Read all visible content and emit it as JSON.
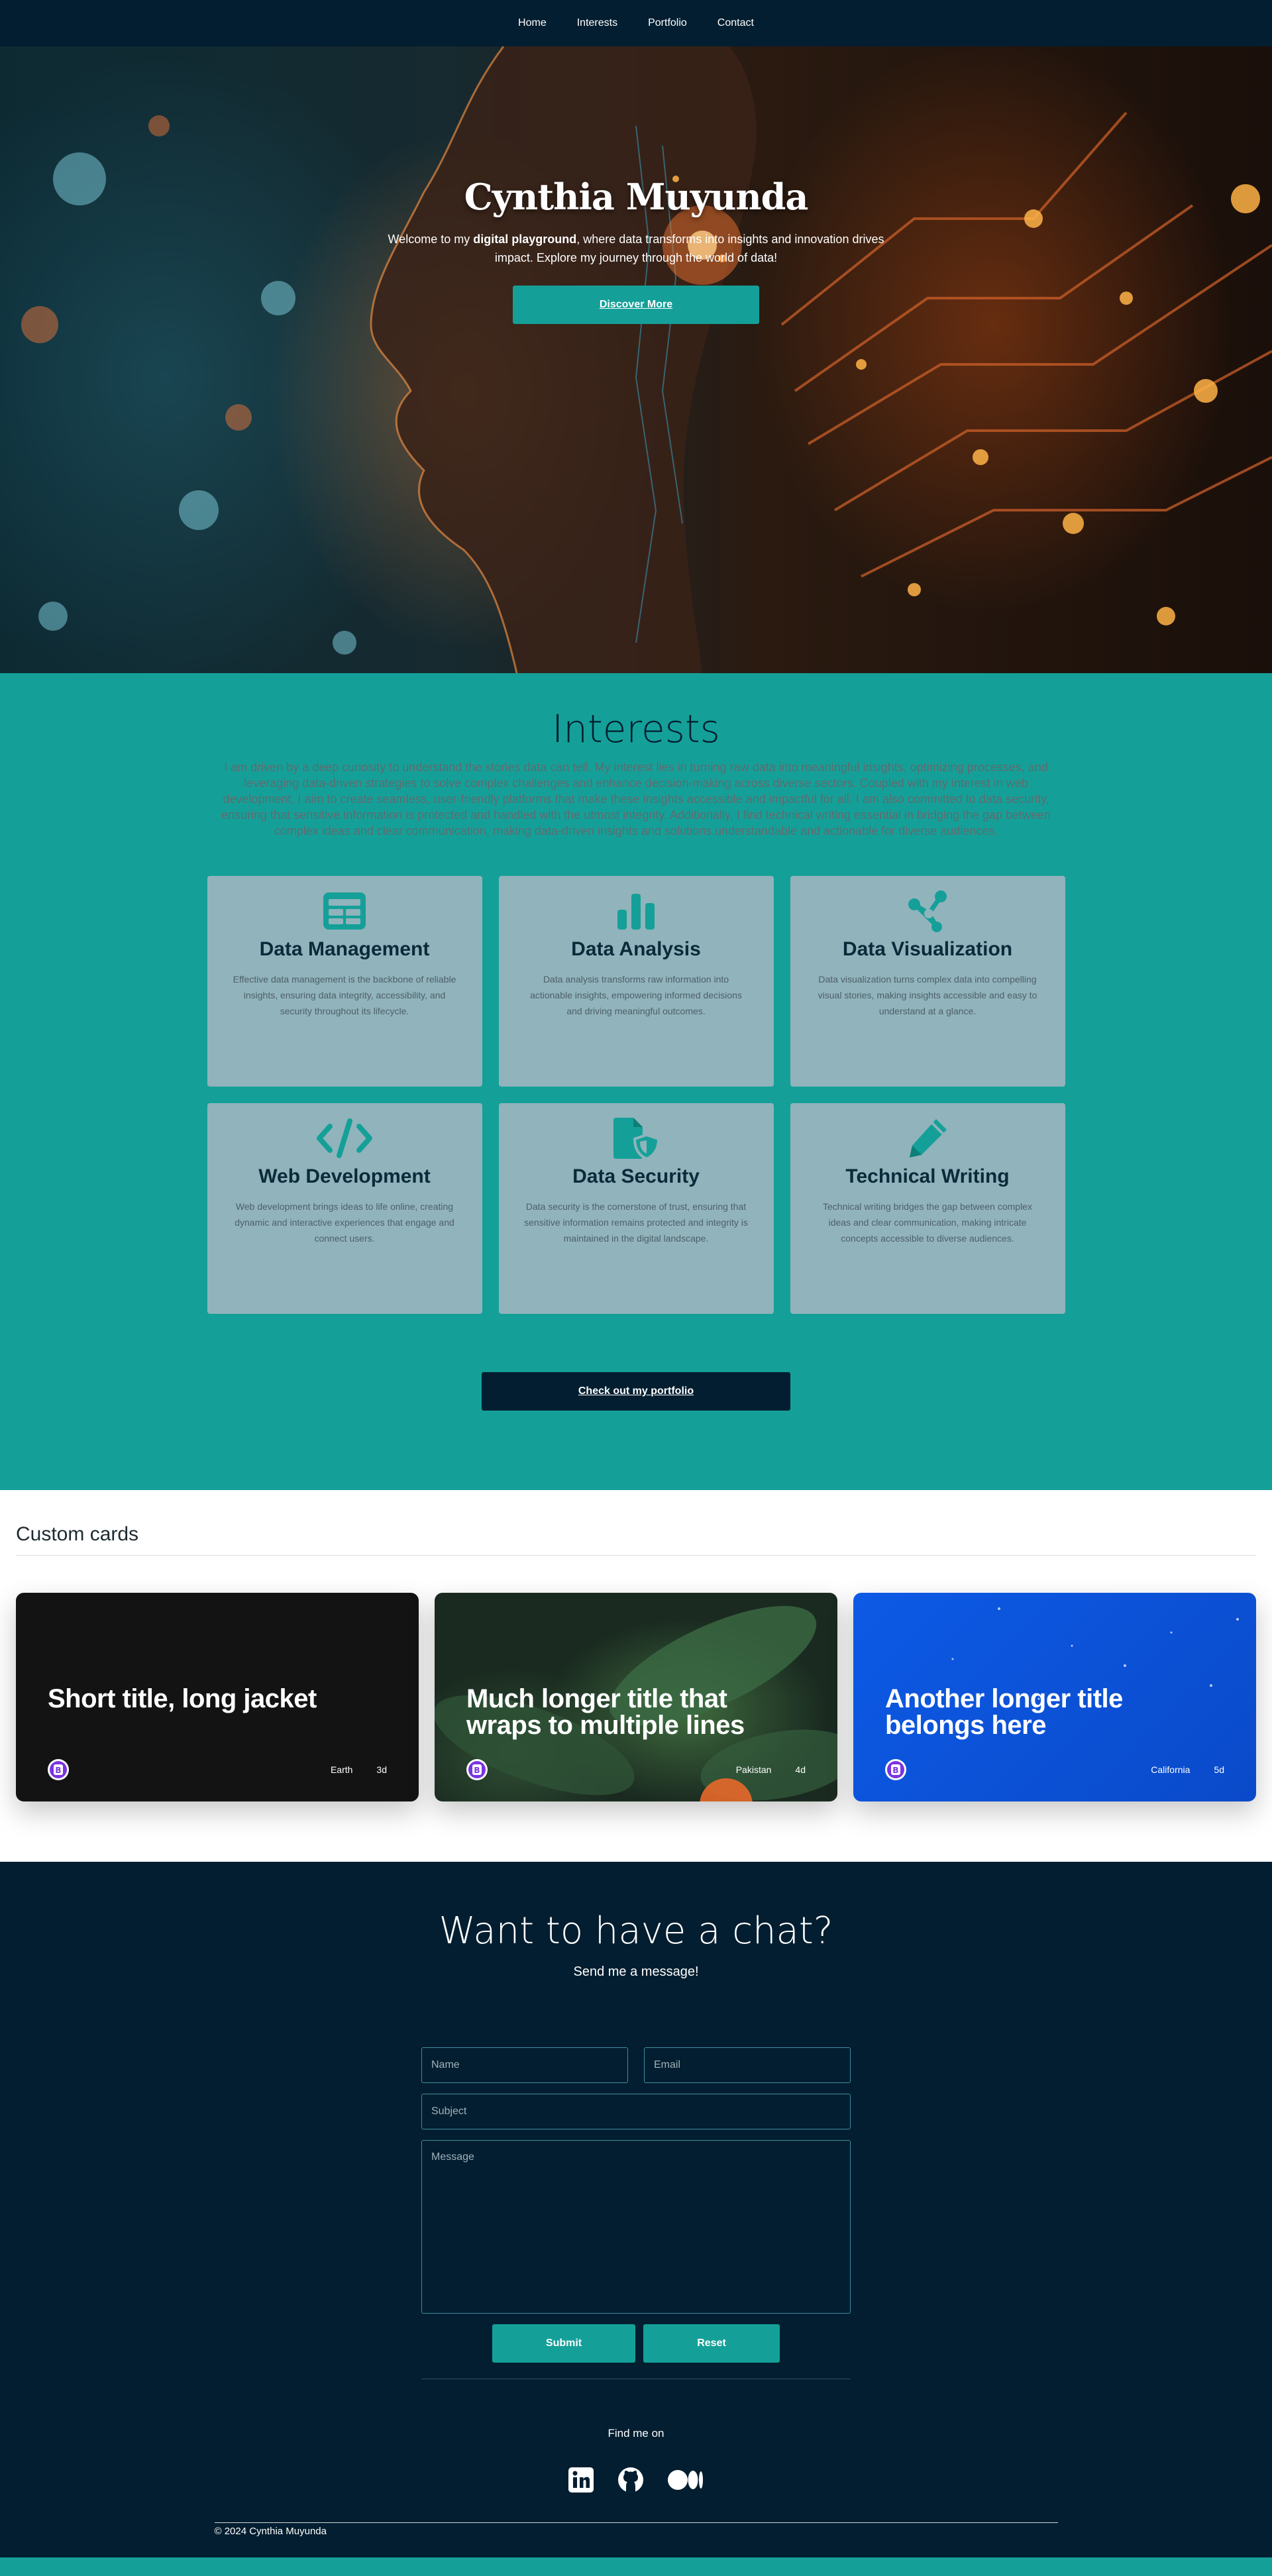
{
  "nav": {
    "items": [
      "Home",
      "Interests",
      "Portfolio",
      "Contact"
    ]
  },
  "hero": {
    "title": "Cynthia Muyunda",
    "subtitle_pre": "Welcome to my ",
    "subtitle_bold": "digital playground",
    "subtitle_post": ", where data transforms into insights and innovation drives impact. Explore my journey through the world of data!",
    "button": "Discover More"
  },
  "interests": {
    "title": "Interests",
    "text": "I am driven by a deep curiosity to understand the stories data can tell. My interest lies in turning raw data into meaningful insights, optimizing processes, and leveraging data-driven strategies to solve complex challenges and enhance decision-making across diverse sectors. Coupled with my interest in web development, I aim to create seamless, user-friendly platforms that make these insights accessible and impactful for all. I am also committed to data security, ensuring that sensitive information is protected and handled with the utmost integrity. Additionally, I find technical writing essential in bridging the gap between complex ideas and clear communication, making data-driven insights and solutions understandable and actionable for diverse audiences.",
    "cards": [
      {
        "icon": "table-icon",
        "title": "Data Management",
        "text": "Effective data management is the backbone of reliable insights, ensuring data integrity, accessibility, and security throughout its lifecycle."
      },
      {
        "icon": "bar-chart-icon",
        "title": "Data Analysis",
        "text": "Data analysis transforms raw information into actionable insights, empowering informed decisions and driving meaningful outcomes."
      },
      {
        "icon": "share-nodes-icon",
        "title": "Data Visualization",
        "text": "Data visualization turns complex data into compelling visual stories, making insights accessible and easy to understand at a glance."
      },
      {
        "icon": "code-icon",
        "title": "Web Development",
        "text": "Web development brings ideas to life online, creating dynamic and interactive experiences that engage and connect users."
      },
      {
        "icon": "file-shield-icon",
        "title": "Data Security",
        "text": "Data security is the cornerstone of trust, ensuring that sensitive information remains protected and integrity is maintained in the digital landscape."
      },
      {
        "icon": "pen-icon",
        "title": "Technical Writing",
        "text": "Technical writing bridges the gap between complex ideas and clear communication, making intricate concepts accessible to diverse audiences."
      }
    ],
    "button": "Check out my portfolio"
  },
  "custom_cards": {
    "title": "Custom cards",
    "cards": [
      {
        "title": "Short title, long jacket",
        "location": "Earth",
        "time": "3d",
        "bg": "#141313"
      },
      {
        "title": "Much longer title that wraps to multiple lines",
        "location": "Pakistan",
        "time": "4d",
        "bg": "#1f3327"
      },
      {
        "title": "Another longer title belongs here",
        "location": "California",
        "time": "5d",
        "bg": "#0d5ae6"
      }
    ]
  },
  "contact": {
    "title": "Want to have a chat?",
    "subtitle": "Send me a message!",
    "placeholders": {
      "name": "Name",
      "email": "Email",
      "subject": "Subject",
      "message": "Message"
    },
    "submit": "Submit",
    "reset": "Reset",
    "find_me": "Find me on",
    "socials": [
      "linkedin-icon",
      "github-icon",
      "medium-icon"
    ],
    "copyright": "© 2024 Cynthia Muyunda"
  },
  "colors": {
    "navy": "#031e30",
    "teal": "#14a098",
    "card": "#91b3bc",
    "badge": "#7a34e0"
  }
}
